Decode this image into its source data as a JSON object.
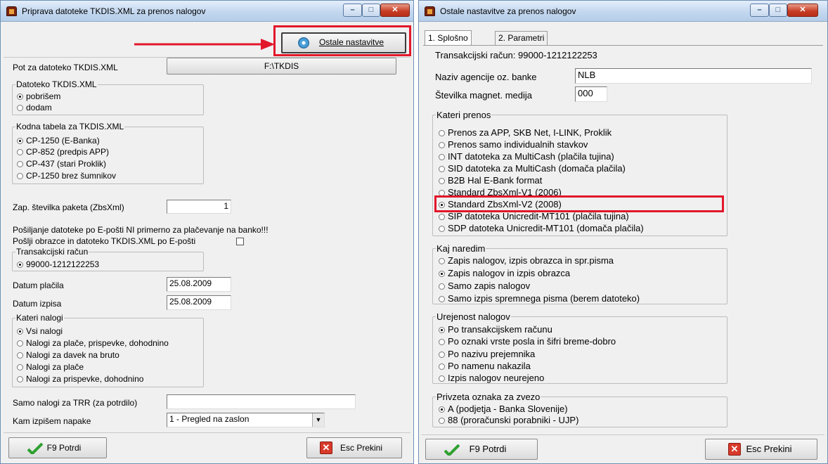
{
  "left_window": {
    "title": "Priprava datoteke TKDIS.XML za prenos nalogov",
    "ostale_button": "Ostale nastavitve",
    "path_label": "Pot za datoteko TKDIS.XML",
    "path_value": "F:\\TKDIS",
    "datoteko_group": {
      "title": "Datoteko TKDIS.XML",
      "options": [
        "pobrišem",
        "dodam"
      ],
      "selected": 0
    },
    "kodna_group": {
      "title": "Kodna tabela za TKDIS.XML",
      "options": [
        "CP-1250 (E-Banka)",
        "CP-852 (predpis APP)",
        "CP-437 (stari Proklik)",
        "CP-1250 brez šumnikov"
      ],
      "selected": 0
    },
    "zap_label": "Zap. številka paketa (ZbsXml)",
    "zap_value": "1",
    "email_warning": "Pošiljanje datoteke po E-pošti NI primerno za plačevanje na banko!!!",
    "email_check_label": "Pošlji obrazce in datoteko TKDIS.XML po E-pošti",
    "trr_group": {
      "title": "Transakcijski račun",
      "options": [
        "99000-1212122253"
      ],
      "selected": 0
    },
    "datum_placila_label": "Datum plačila",
    "datum_placila_value": "25.08.2009",
    "datum_izpisa_label": "Datum izpisa",
    "datum_izpisa_value": "25.08.2009",
    "kateri_group": {
      "title": "Kateri nalogi",
      "options": [
        "Vsi nalogi",
        "Nalogi za plače, prispevke, dohodnino",
        "Nalogi za davek na bruto",
        "Nalogi za plače",
        "Nalogi za prispevke, dohodnino"
      ],
      "selected": 0
    },
    "samo_label": "Samo nalogi za TRR (za potrdilo)",
    "samo_value": "",
    "kam_label": "Kam izpišem napake",
    "kam_value": "1 - Pregled na zaslon",
    "ok_button": "F9 Potrdi",
    "cancel_button": "Esc Prekini"
  },
  "right_window": {
    "title": "Ostale nastavitve za prenos nalogov",
    "tabs": [
      "1. Splošno",
      "2. Parametri"
    ],
    "trr_line": "Transakcijski račun: 99000-1212122253",
    "naziv_label": "Naziv agencije oz. banke",
    "naziv_value": "NLB",
    "stevilka_label": "Številka magnet. medija",
    "stevilka_value": "000",
    "prenos_group": {
      "title": "Kateri prenos",
      "options": [
        "Prenos za APP, SKB Net, I-LINK, Proklik",
        "Prenos samo individualnih stavkov",
        "INT datoteka za MultiCash (plačila tujina)",
        "SID datoteka za MultiCash (domača plačila)",
        "B2B Hal E-Bank format",
        "Standard ZbsXml-V1 (2006)",
        "Standard ZbsXml-V2 (2008)",
        "SIP datoteka Unicredit-MT101 (plačila tujina)",
        "SDP datoteka Unicredit-MT101 (domača plačila)"
      ],
      "selected": 6
    },
    "naredim_group": {
      "title": "Kaj naredim",
      "options": [
        "Zapis nalogov, izpis obrazca in spr.pisma",
        "Zapis nalogov in izpis obrazca",
        "Samo zapis nalogov",
        "Samo izpis spremnega pisma (berem datoteko)"
      ],
      "selected": 1
    },
    "urejenost_group": {
      "title": "Urejenost nalogov",
      "options": [
        "Po transakcijskem računu",
        "Po oznaki vrste posla in šifri breme-dobro",
        "Po nazivu prejemnika",
        "Po namenu nakazila",
        "Izpis nalogov neurejeno"
      ],
      "selected": 0
    },
    "oznaka_group": {
      "title": "Privzeta oznaka za zvezo",
      "options": [
        "A (podjetja - Banka Slovenije)",
        "88 (proračunski porabniki - UJP)"
      ],
      "selected": 0
    },
    "ok_button": "F9 Potrdi",
    "cancel_button": "Esc Prekini"
  },
  "accent_colors": {
    "highlight": "#e2172a",
    "titlebar": "#c3d7ef",
    "ok_check": "#2fa02f",
    "cancel_x": "#d83a2a"
  }
}
